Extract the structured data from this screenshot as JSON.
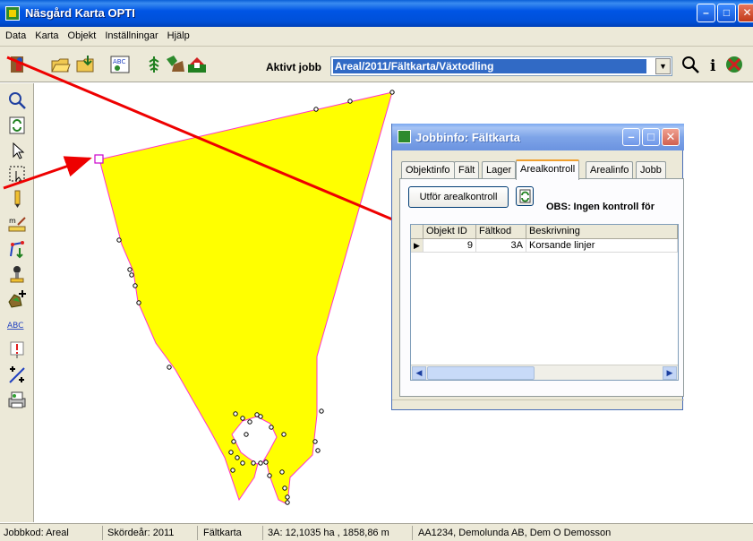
{
  "window": {
    "title": "Näsgård Karta OPTI"
  },
  "menu": [
    "Data",
    "Karta",
    "Objekt",
    "Inställningar",
    "Hjälp"
  ],
  "toolbar": {
    "active_job_label": "Aktivt jobb",
    "active_job_value": "Areal/2011/Fältkarta/Växtodling"
  },
  "dialog": {
    "title": "Jobbinfo: Fältkarta",
    "tabs": [
      "Objektinfo",
      "Fält",
      "Lager",
      "Arealkontroll",
      "Arealinfo",
      "Jobb"
    ],
    "active_tab": "Arealkontroll",
    "run_button": "Utför arealkontroll",
    "notice": "OBS: Ingen kontroll för",
    "grid": {
      "columns": [
        "Objekt ID",
        "Fältkod",
        "Beskrivning"
      ],
      "rows": [
        {
          "id": "9",
          "code": "3A",
          "desc": "Korsande linjer"
        }
      ]
    }
  },
  "statusbar": {
    "jobbkod": "Jobbkod: Areal",
    "skordear": "Skördeår: 2011",
    "karta": "Fältkarta",
    "area": "3A: 12,1035 ha , 1858,86 m",
    "owner": "AA1234, Demolunda AB, Dem O Demosson"
  },
  "colors": {
    "field_fill": "#ffff00",
    "field_border": "#ff33cc",
    "annotation_arrow": "#ee0000"
  }
}
